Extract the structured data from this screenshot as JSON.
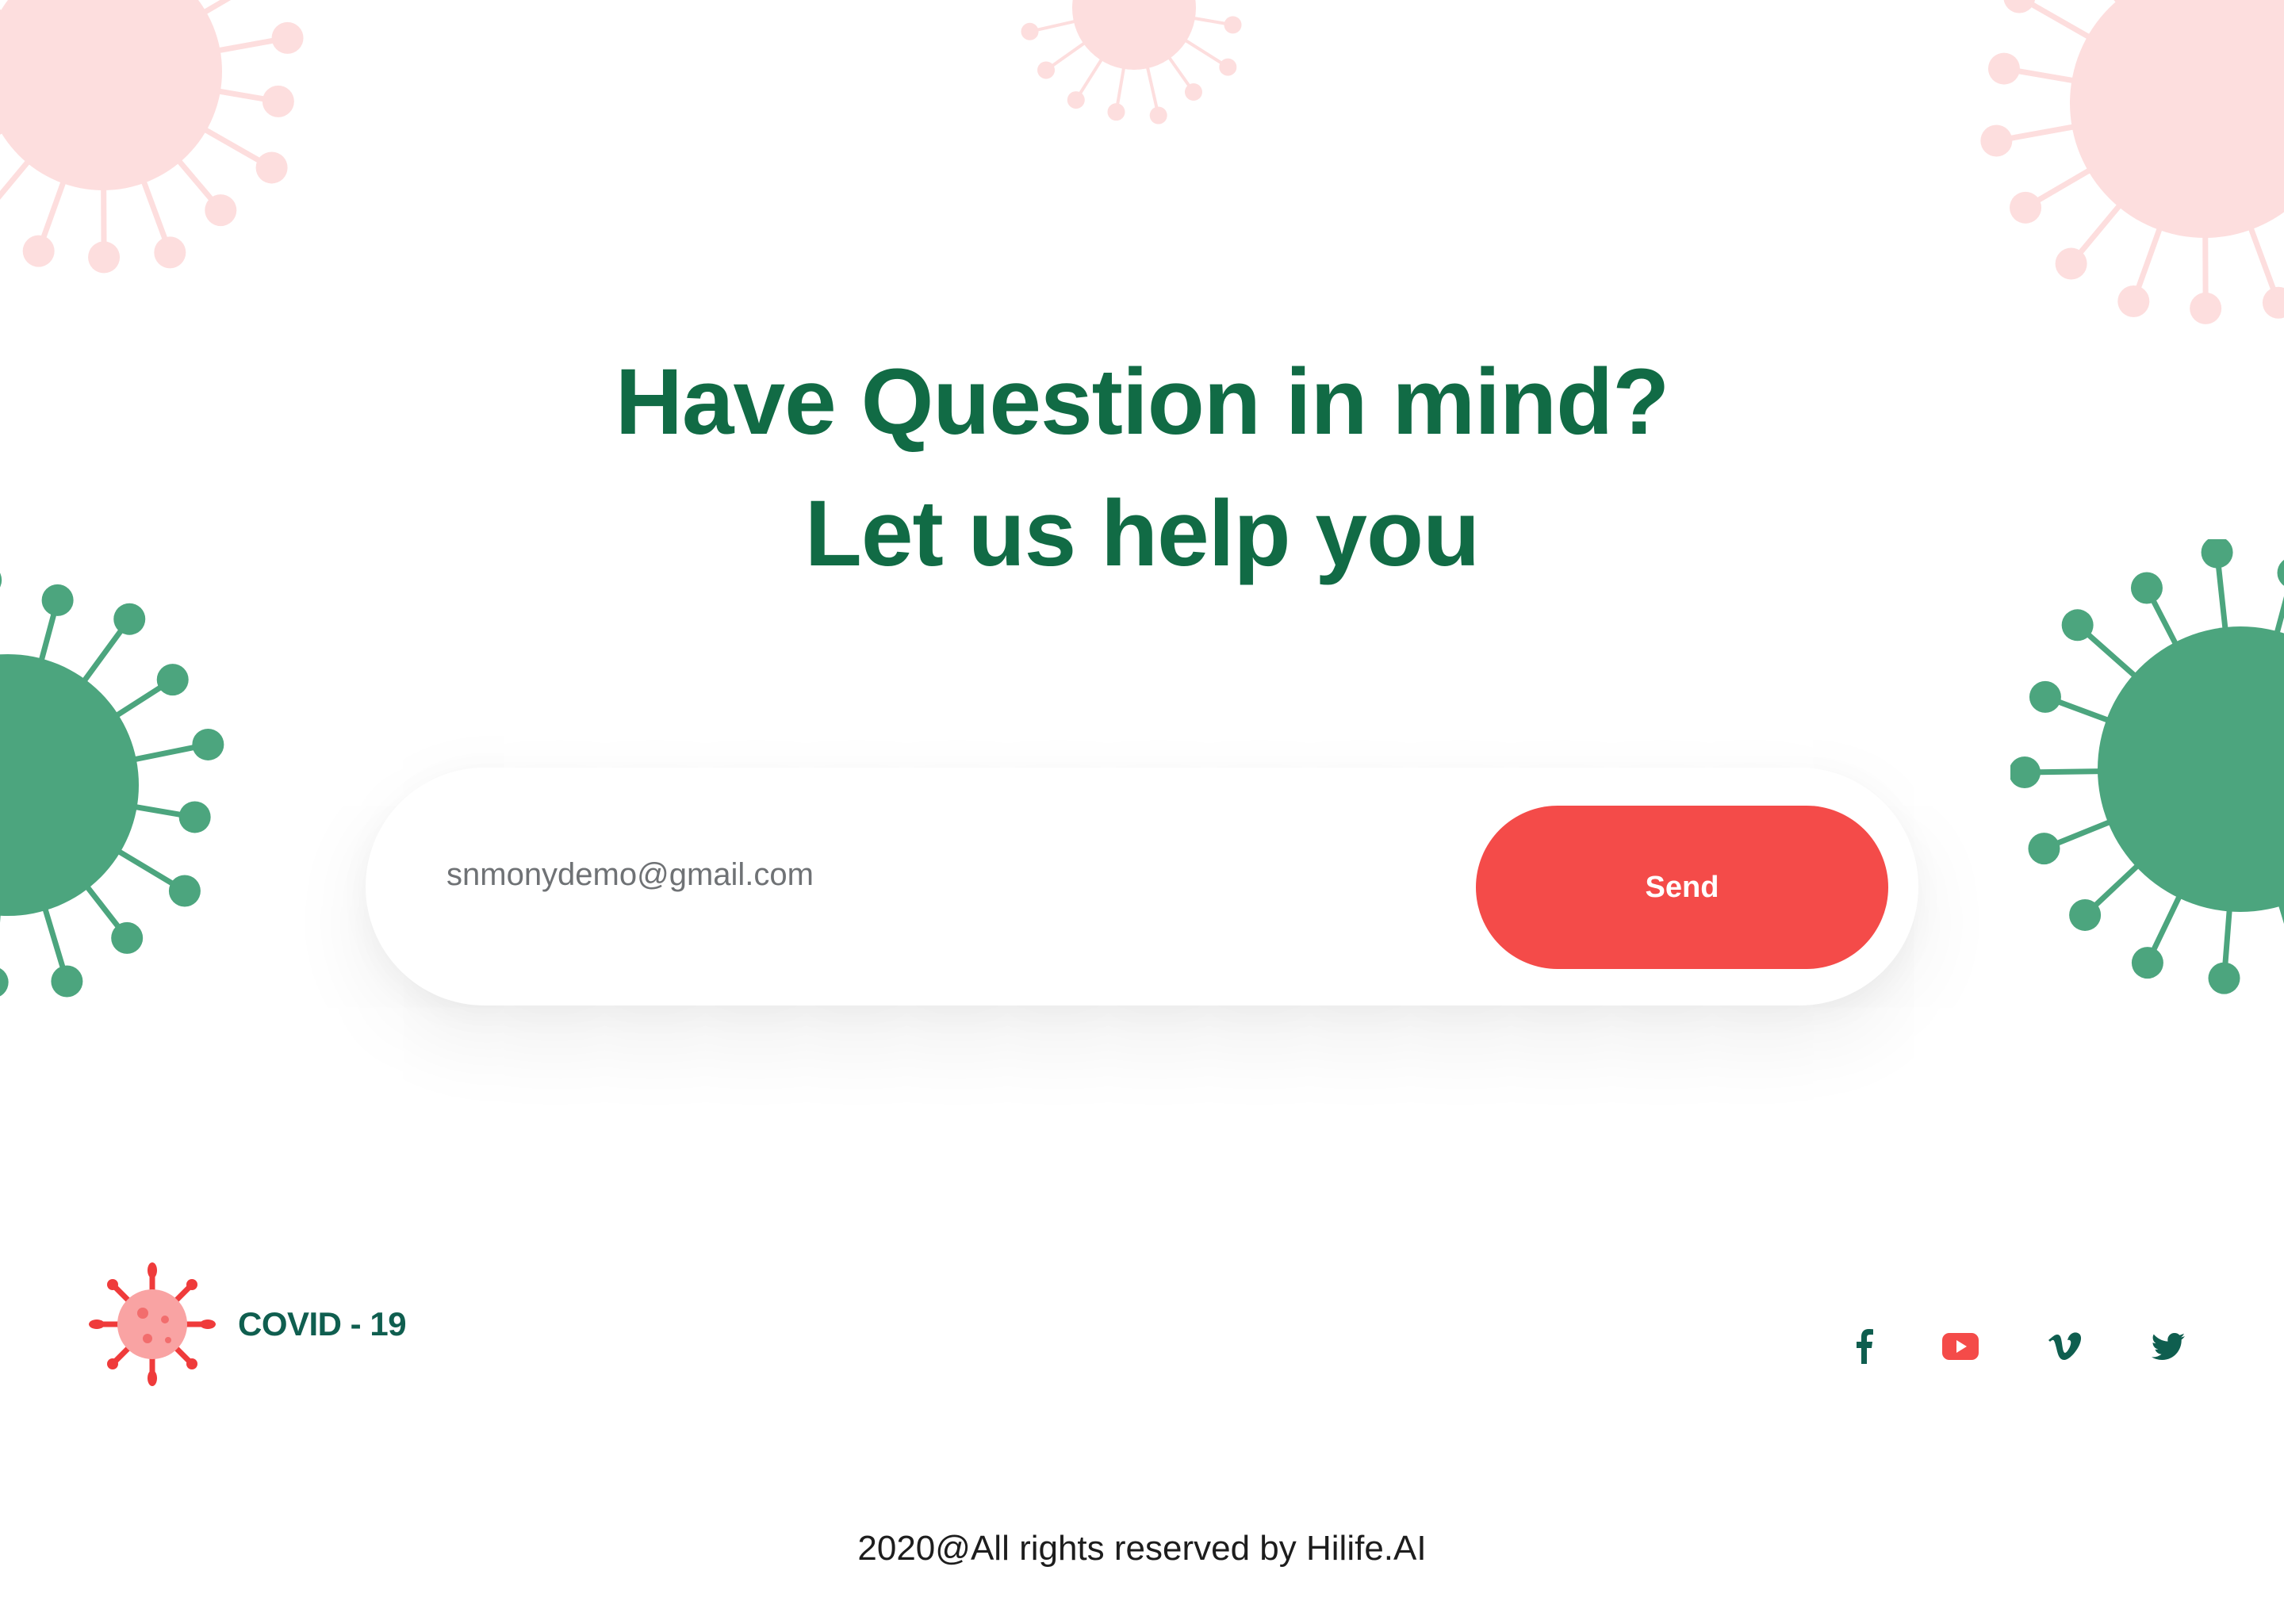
{
  "colors": {
    "heading": "#116b45",
    "accent": "#f44b49",
    "virus_pink": "#fddede",
    "virus_green": "#4ca57e",
    "brand_text": "#0f5e4f",
    "social_icon": "#0f5e4f"
  },
  "hero": {
    "heading_line1": "Have Question in mind?",
    "heading_line2": "Let us help you"
  },
  "subscribe": {
    "email_placeholder": "snmonydemo@gmail.com",
    "send_label": "Send"
  },
  "footer": {
    "brand_icon": "covid-virus-icon",
    "brand_name": "COVID - 19",
    "social": [
      {
        "name": "facebook",
        "icon": "facebook-icon"
      },
      {
        "name": "youtube",
        "icon": "youtube-icon"
      },
      {
        "name": "vimeo",
        "icon": "vimeo-icon"
      },
      {
        "name": "twitter",
        "icon": "twitter-icon"
      }
    ],
    "copyright": "2020@All rights reserved by Hilife.AI"
  }
}
